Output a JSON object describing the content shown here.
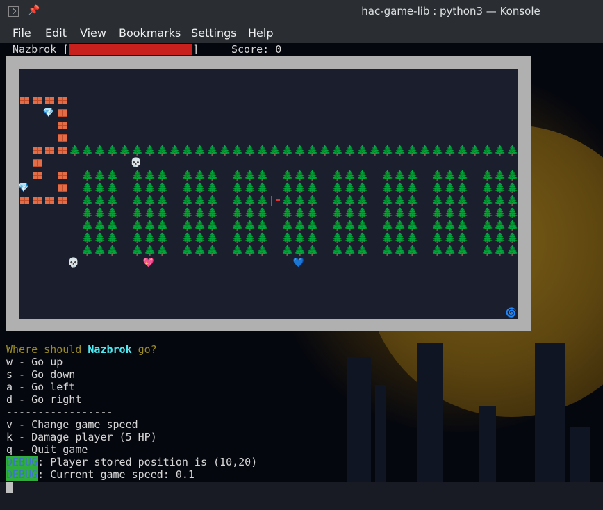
{
  "window": {
    "title": "hac-game-lib : python3 — Konsole"
  },
  "menu": [
    "File",
    "Edit",
    "View",
    "Bookmarks",
    "Settings",
    "Help"
  ],
  "hud": {
    "player_name": "Nazbrok",
    "bracket_open": "[",
    "bracket_close": "]",
    "health_fraction": 1.0,
    "score_label": "Score: 0"
  },
  "board": {
    "icons": {
      "brick": "brick-wall-icon",
      "tree": "tree-icon",
      "diamond": "diamond-icon",
      "skull": "skull-icon",
      "heart_sparkle": "heart-sparkle-icon",
      "blue_heart": "blue-heart-icon",
      "portal": "portal-icon"
    },
    "colors": {
      "health": "#c8201c",
      "brick": "#e36d46",
      "tree": "#3f9e2a",
      "player": "#dd3333"
    }
  },
  "console": {
    "prompt_prefix": "Where should ",
    "prompt_name": "Nazbrok",
    "prompt_suffix": " go?",
    "options": [
      "w - Go up",
      "s - Go down",
      "a - Go left",
      "d - Go right",
      "-----------------",
      "v - Change game speed",
      "k - Damage player (5 HP)",
      "q - Quit game"
    ],
    "debug_tag": "DEBUG",
    "debug_lines": [
      ": Player stored position is (10,20)",
      ": Current game speed: 0.1"
    ]
  }
}
